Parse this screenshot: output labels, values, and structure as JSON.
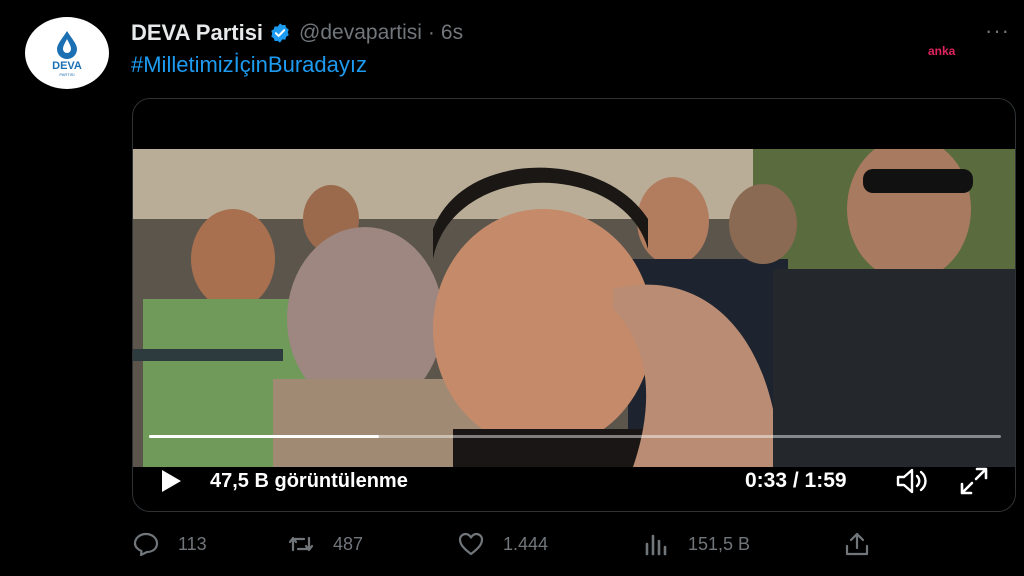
{
  "tweet": {
    "author_name": "DEVA Partisi",
    "handle": "@devapartisi",
    "separator": "·",
    "time": "6s",
    "hashtag": "#MilletimizİçinBuradayız",
    "more_label": "···",
    "avatar_logo_text": "DEVA",
    "avatar_logo_sub": "PARTISI"
  },
  "watermark": "anka",
  "video": {
    "views_label": "47,5 B görüntülenme",
    "time_display": "0:33 / 1:59",
    "progress": 0.27
  },
  "actions": {
    "replies": "113",
    "retweets": "487",
    "likes": "1.444",
    "views": "151,5 B"
  },
  "colors": {
    "background": "#000000",
    "link": "#1d9bf0",
    "muted": "#71767b",
    "verified": "#1d9bf0",
    "watermark": "#e0245e"
  },
  "icons": [
    "deva-drop-icon",
    "verified-badge-icon",
    "more-icon",
    "play-icon",
    "volume-icon",
    "fullscreen-icon",
    "reply-icon",
    "retweet-icon",
    "like-icon",
    "views-chart-icon",
    "share-icon"
  ]
}
